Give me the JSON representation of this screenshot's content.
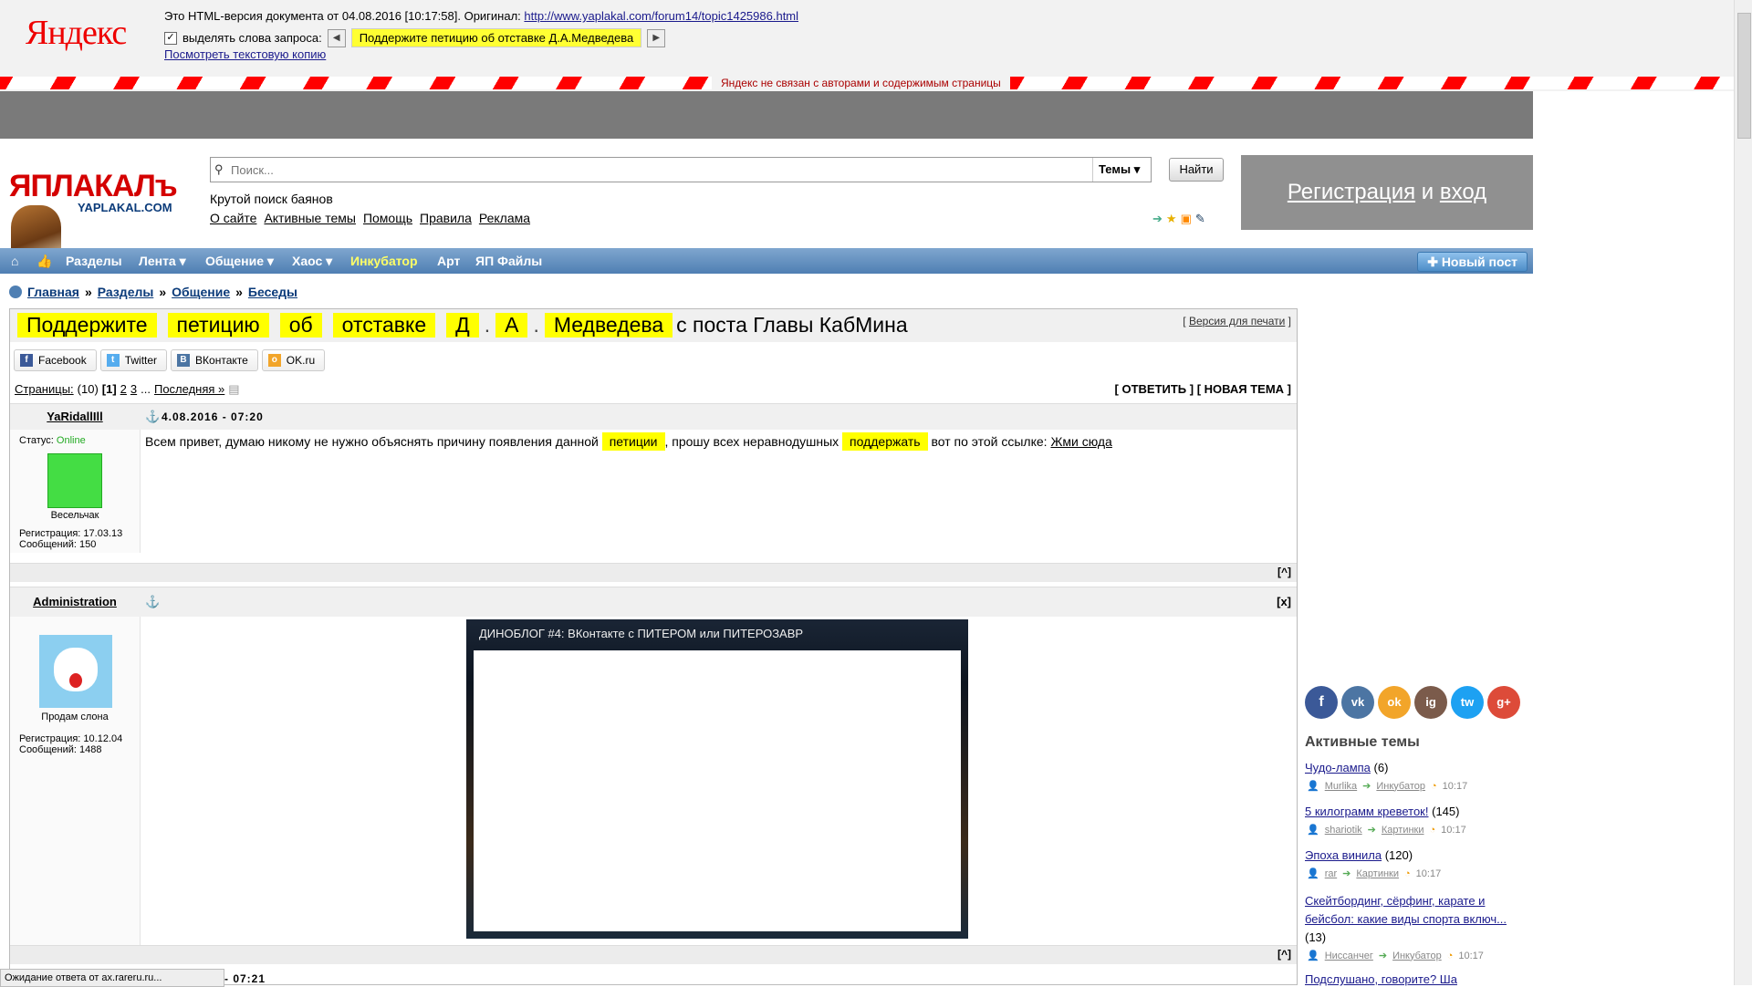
{
  "yandex": {
    "logo": "Яндекс",
    "line1_text": "Это HTML-версия документа от 04.08.2016 [10:17:58]. Оригинал:",
    "original_url": "http://www.yaplakal.com/forum14/topic1425986.html",
    "highlight_label": "выделять слова запроса:",
    "query": "Поддержите петицию об отставке Д.А.Медведева",
    "text_copy_link": "Посмотреть текстовую копию",
    "disclaimer": "Яндекс не связан с авторами и содержимым страницы"
  },
  "site": {
    "logo_text": "ЯПЛАКАЛъ",
    "logo_sub": "YAPLAKAL.COM",
    "search_placeholder": "Поиск...",
    "search_scope": "Темы",
    "search_button": "Найти",
    "search_hint": "Крутой поиск баянов",
    "links": [
      "О сайте",
      "Активные темы",
      "Помощь",
      "Правила",
      "Реклама"
    ],
    "reg_link": "Регистрация",
    "reg_and": "и",
    "login_link": "вход"
  },
  "menu": {
    "items": [
      "Разделы",
      "Лента ▾",
      "Общение ▾",
      "Хаос ▾",
      "Инкубатор",
      "Арт",
      "ЯП Файлы"
    ],
    "new_post": "Новый пост"
  },
  "breadcrumb": [
    "Главная",
    "Разделы",
    "Общение",
    "Беседы"
  ],
  "topic": {
    "title_words": [
      "Поддержите",
      "петицию",
      "об",
      "отставке",
      "Д",
      "А",
      "Медведева"
    ],
    "title_rest": "с поста Главы КабМина",
    "print_version": "Версия для печати",
    "share": [
      "Facebook",
      "Twitter",
      "ВКонтакте",
      "OK.ru"
    ],
    "pages_label": "Страницы:",
    "pages_count": "(10)",
    "pages_current": "[1]",
    "pages": [
      "2",
      "3"
    ],
    "pages_ellipsis": "...",
    "pages_last": "Последняя »",
    "reply": "[ ОТВЕТИТЬ ] [ НОВАЯ ТЕМА ]"
  },
  "posts": [
    {
      "author": "YaRidallIll",
      "date": "4.08.2016 - 07:20",
      "status_label": "Статус:",
      "status": "Online",
      "rank": "Весельчак",
      "reg": "Регистрация: 17.03.13",
      "msgs": "Сообщений: 150",
      "text_1": "Всем привет, думаю никому не нужно объяснять причину появления данной",
      "hl_1": "петиции",
      "text_2": ", прошу всех неравнодушных",
      "hl_2": "поддержать",
      "text_3": "вот по этой ссылке:",
      "link": "Жми сюда"
    },
    {
      "author": "Administration",
      "close": "[x]",
      "rank": "Продам слона",
      "reg": "Регистрация: 10.12.04",
      "msgs": "Сообщений: 1488",
      "video_title": "ДИНОБЛОГ #4: ВКонтакте с ПИТЕРОМ или ПИТЕРОЗАВР"
    }
  ],
  "to_top": "[^]",
  "next_post_time": "- 07:21",
  "sidebar": {
    "social": [
      "f",
      "vk",
      "ok",
      "ig",
      "tw",
      "g+"
    ],
    "active_title": "Активные темы",
    "topics": [
      {
        "title": "Чудо-лампа",
        "count": "(6)",
        "user": "Murlika",
        "section": "Инкубатор",
        "time": "10:17"
      },
      {
        "title": "5 килограмм креветок!",
        "count": "(145)",
        "user": "shariotik",
        "section": "Картинки",
        "time": "10:17"
      },
      {
        "title": "Эпоха винила",
        "count": "(120)",
        "user": "rar",
        "section": "Картинки",
        "time": "10:17"
      },
      {
        "title": "Скейтбординг, сёрфинг, карате и бейсбол: какие виды спорта включ...",
        "count": "(13)",
        "user": "Ниссанчег",
        "section": "Инкубатор",
        "time": "10:17"
      },
      {
        "title": "Подслушано, говорите? Ша"
      }
    ]
  },
  "status_bar": "Ожидание ответа от ax.rareru.ru...",
  "colors": {
    "highlight": "#ffff00",
    "menu_blue": "#4f7fb3",
    "yandex_red": "#ee0000"
  }
}
